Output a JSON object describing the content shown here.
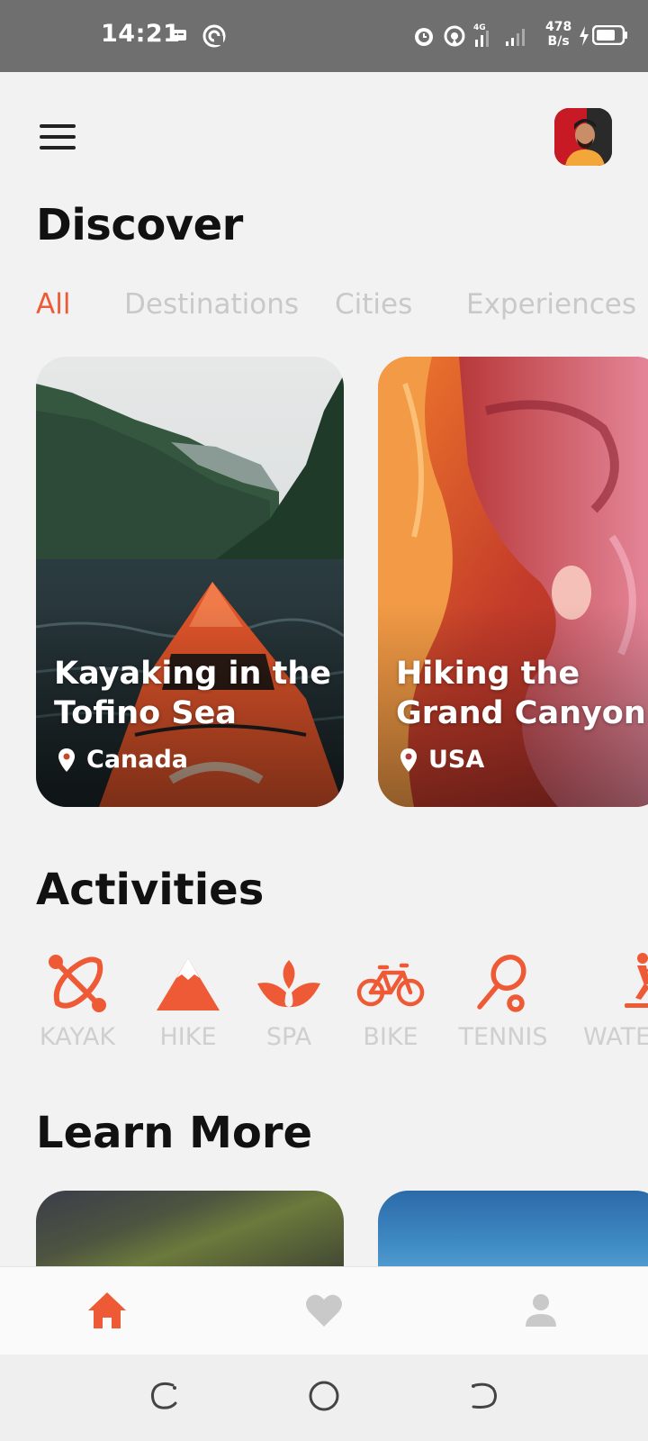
{
  "status_bar": {
    "time": "14:21",
    "speed_value": "478",
    "speed_unit": "B/s"
  },
  "header": {
    "title": "Discover"
  },
  "tabs": [
    {
      "label": "All",
      "active": true
    },
    {
      "label": "Destinations",
      "active": false
    },
    {
      "label": "Cities",
      "active": false
    },
    {
      "label": "Experiences",
      "active": false
    }
  ],
  "cards": [
    {
      "title": "Kayaking in the Tofino Sea",
      "location": "Canada"
    },
    {
      "title": "Hiking the Grand Canyon",
      "location": "USA"
    }
  ],
  "activities": {
    "title": "Activities",
    "items": [
      {
        "label": "KAYAK",
        "icon": "kayak-icon"
      },
      {
        "label": "HIKE",
        "icon": "mountain-icon"
      },
      {
        "label": "SPA",
        "icon": "lotus-icon"
      },
      {
        "label": "BIKE",
        "icon": "bike-icon"
      },
      {
        "label": "TENNIS",
        "icon": "tennis-icon"
      },
      {
        "label": "WATE",
        "icon": "waterski-icon"
      }
    ]
  },
  "learn_more": {
    "title": "Learn More"
  },
  "bottom_nav": [
    {
      "icon": "home-icon",
      "active": true
    },
    {
      "icon": "heart-icon",
      "active": false
    },
    {
      "icon": "person-icon",
      "active": false
    }
  ],
  "colors": {
    "accent": "#ee5a36",
    "inactive": "#c9c9c9",
    "background": "#f2f2f2"
  }
}
